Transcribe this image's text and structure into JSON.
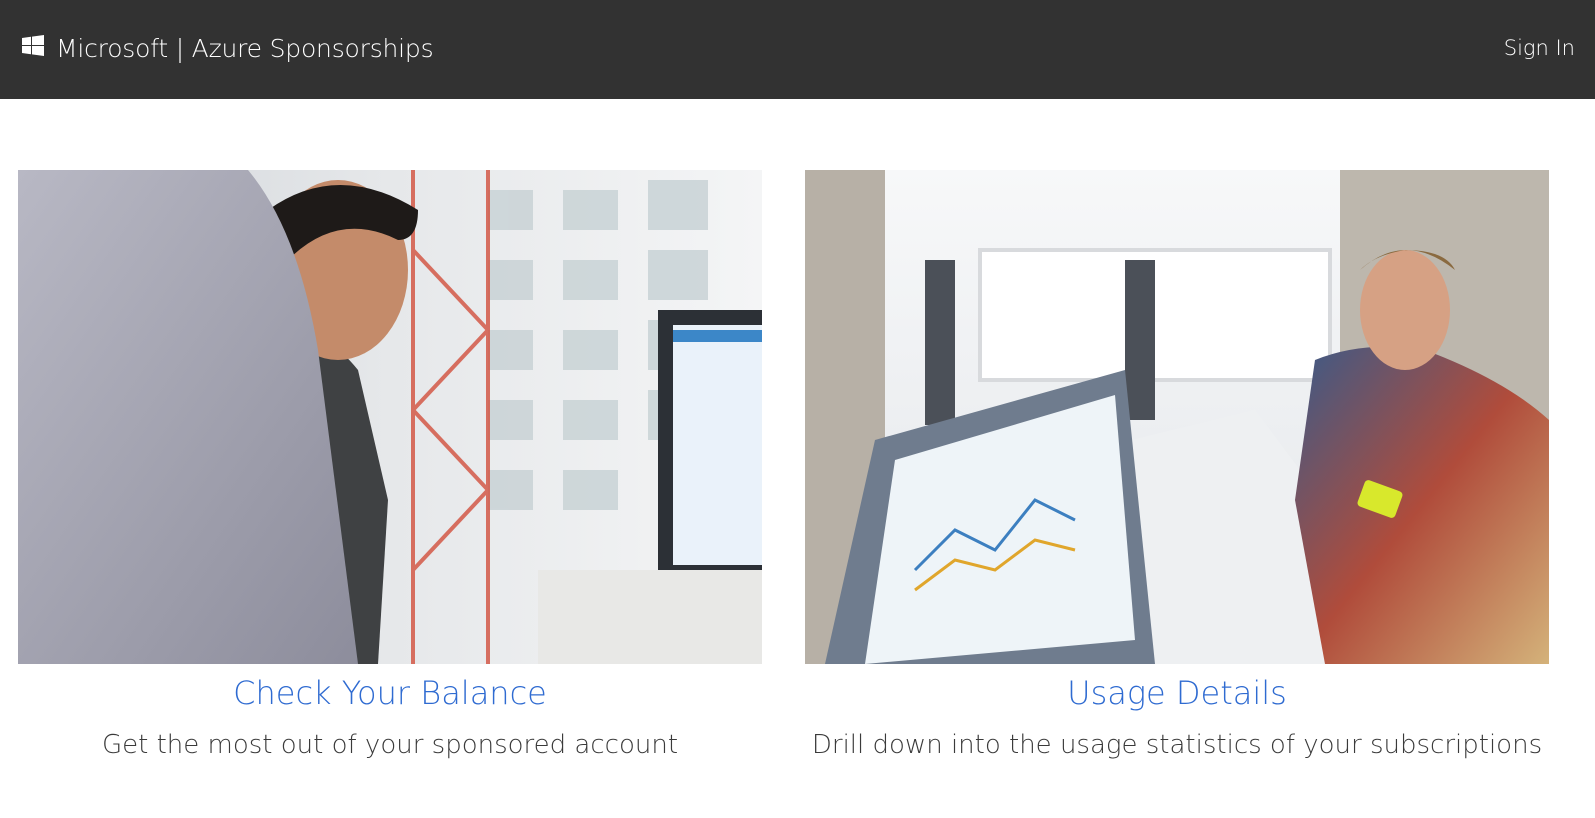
{
  "header": {
    "brand": "Microsoft | Azure Sponsorships",
    "sign_in": "Sign In",
    "logo_icon": "windows-logo-icon",
    "background_color": "#323232"
  },
  "cards": [
    {
      "title": "Check Your Balance",
      "description": "Get the most out of your sponsored account",
      "image": "office-photo-man-at-monitor"
    },
    {
      "title": "Usage Details",
      "description": "Drill down into the usage statistics of your subscriptions",
      "image": "office-photo-man-with-phone-and-analytics-screen"
    }
  ],
  "colors": {
    "link": "#2f6bd1",
    "text": "#3a3a3a"
  }
}
